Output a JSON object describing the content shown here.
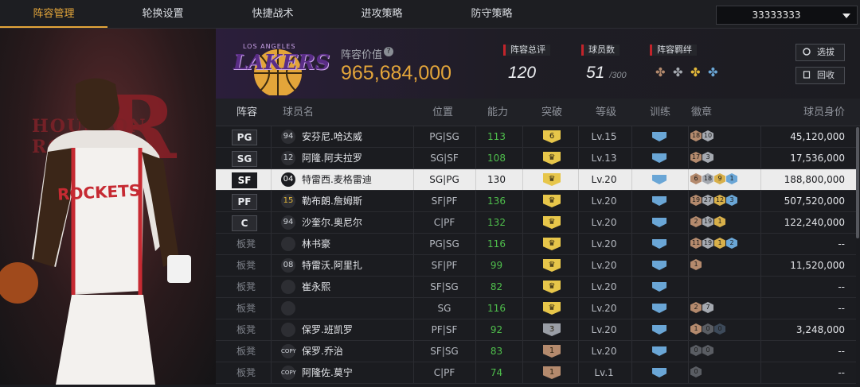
{
  "nav": {
    "tabs": [
      "阵容管理",
      "轮换设置",
      "快捷战术",
      "进攻策略",
      "防守策略"
    ],
    "account": "33333333"
  },
  "header": {
    "value_label": "阵容价值",
    "value": "965,684,000",
    "rating_label": "阵容总评",
    "rating": "120",
    "count_label": "球员数",
    "count": "51",
    "count_max": "/300",
    "bond_label": "阵容羁绊",
    "scout_label": "选拔",
    "recycle_label": "回收",
    "logo_top": "LOS ANGELES",
    "logo_text": "LAKERS"
  },
  "left_panel": {
    "bg_text": "HOUSTON ROCKETS",
    "jersey_text": "ROCKETS"
  },
  "columns": [
    "阵容",
    "球员名",
    "位置",
    "能力",
    "突破",
    "等级",
    "训练",
    "徽章",
    "球员身价"
  ],
  "rows": [
    {
      "slot": "PG",
      "num": "94",
      "name": "安芬尼.哈达威",
      "pos": "PG|SG",
      "ability": "113",
      "brk": "6",
      "brk_color": "#e7c64a",
      "level": "Lv.15",
      "badges": [
        [
          "18",
          "#b48a6d"
        ],
        [
          "10",
          "#a5a9b0"
        ]
      ],
      "worth": "45,120,000"
    },
    {
      "slot": "SG",
      "num": "12",
      "name": "阿隆.阿夫拉罗",
      "pos": "SG|SF",
      "ability": "108",
      "brk": "♛",
      "brk_color": "#e7c64a",
      "level": "Lv.13",
      "badges": [
        [
          "17",
          "#b48a6d"
        ],
        [
          "3",
          "#a5a9b0"
        ]
      ],
      "worth": "17,536,000"
    },
    {
      "slot": "SF",
      "num": "04",
      "name": "特雷西.麦格雷迪",
      "pos": "SG|PG",
      "ability": "130",
      "brk": "♛",
      "brk_color": "#e7c64a",
      "level": "Lv.20",
      "badges": [
        [
          "6",
          "#b48a6d"
        ],
        [
          "18",
          "#a5a9b0"
        ],
        [
          "9",
          "#d8b04a"
        ],
        [
          "1",
          "#6aa6d6"
        ]
      ],
      "worth": "188,800,000"
    },
    {
      "slot": "PF",
      "num": "15",
      "name": "勒布朗.詹姆斯",
      "pos": "SF|PF",
      "ability": "136",
      "brk": "♛",
      "brk_color": "#e7c64a",
      "level": "Lv.20",
      "badges": [
        [
          "19",
          "#b48a6d"
        ],
        [
          "27",
          "#a5a9b0"
        ],
        [
          "12",
          "#d8b04a"
        ],
        [
          "3",
          "#6aa6d6"
        ]
      ],
      "worth": "507,520,000"
    },
    {
      "slot": "C",
      "num": "94",
      "name": "沙奎尔.奥尼尔",
      "pos": "C|PF",
      "ability": "132",
      "brk": "♛",
      "brk_color": "#e7c64a",
      "level": "Lv.20",
      "badges": [
        [
          "2",
          "#b48a6d"
        ],
        [
          "19",
          "#a5a9b0"
        ],
        [
          "1",
          "#d8b04a"
        ]
      ],
      "worth": "122,240,000"
    },
    {
      "slot": "板凳",
      "num": "",
      "name": "林书豪",
      "pos": "PG|SG",
      "ability": "116",
      "brk": "♛",
      "brk_color": "#e7c64a",
      "level": "Lv.20",
      "badges": [
        [
          "11",
          "#b48a6d"
        ],
        [
          "19",
          "#a5a9b0"
        ],
        [
          "1",
          "#d8b04a"
        ],
        [
          "2",
          "#6aa6d6"
        ]
      ],
      "worth": "--"
    },
    {
      "slot": "板凳",
      "num": "08",
      "name": "特雷沃.阿里扎",
      "pos": "SF|PF",
      "ability": "99",
      "brk": "♛",
      "brk_color": "#e7c64a",
      "level": "Lv.20",
      "badges": [
        [
          "1",
          "#b48a6d"
        ]
      ],
      "worth": "11,520,000"
    },
    {
      "slot": "板凳",
      "num": "",
      "name": "崔永熙",
      "pos": "SF|SG",
      "ability": "82",
      "brk": "♛",
      "brk_color": "#e7c64a",
      "level": "Lv.20",
      "badges": [],
      "worth": "--"
    },
    {
      "slot": "板凳",
      "num": "",
      "name": "",
      "pos": "SG",
      "ability": "116",
      "brk": "♛",
      "brk_color": "#e7c64a",
      "level": "Lv.20",
      "badges": [
        [
          "2",
          "#b48a6d"
        ],
        [
          "7",
          "#a5a9b0"
        ]
      ],
      "worth": "--"
    },
    {
      "slot": "板凳",
      "num": "",
      "name": "保罗.班凯罗",
      "pos": "PF|SF",
      "ability": "92",
      "brk": "3",
      "brk_color": "#9a9ea6",
      "level": "Lv.20",
      "badges": [
        [
          "1",
          "#b48a6d"
        ],
        [
          "0",
          "#5a5d63"
        ],
        [
          "0",
          "#3d4a5a"
        ]
      ],
      "worth": "3,248,000"
    },
    {
      "slot": "板凳",
      "num": "COPY",
      "name": "保罗.乔治",
      "pos": "SF|SG",
      "ability": "83",
      "brk": "1",
      "brk_color": "#b48a6d",
      "level": "Lv.20",
      "badges": [
        [
          "0",
          "#5a5d63"
        ],
        [
          "0",
          "#5a5d63"
        ]
      ],
      "worth": "--"
    },
    {
      "slot": "板凳",
      "num": "COPY",
      "name": "阿隆佐.莫宁",
      "pos": "C|PF",
      "ability": "74",
      "brk": "1",
      "brk_color": "#b48a6d",
      "level": "Lv.1",
      "badges": [
        [
          "0",
          "#5a5d63"
        ]
      ],
      "worth": "--"
    }
  ]
}
